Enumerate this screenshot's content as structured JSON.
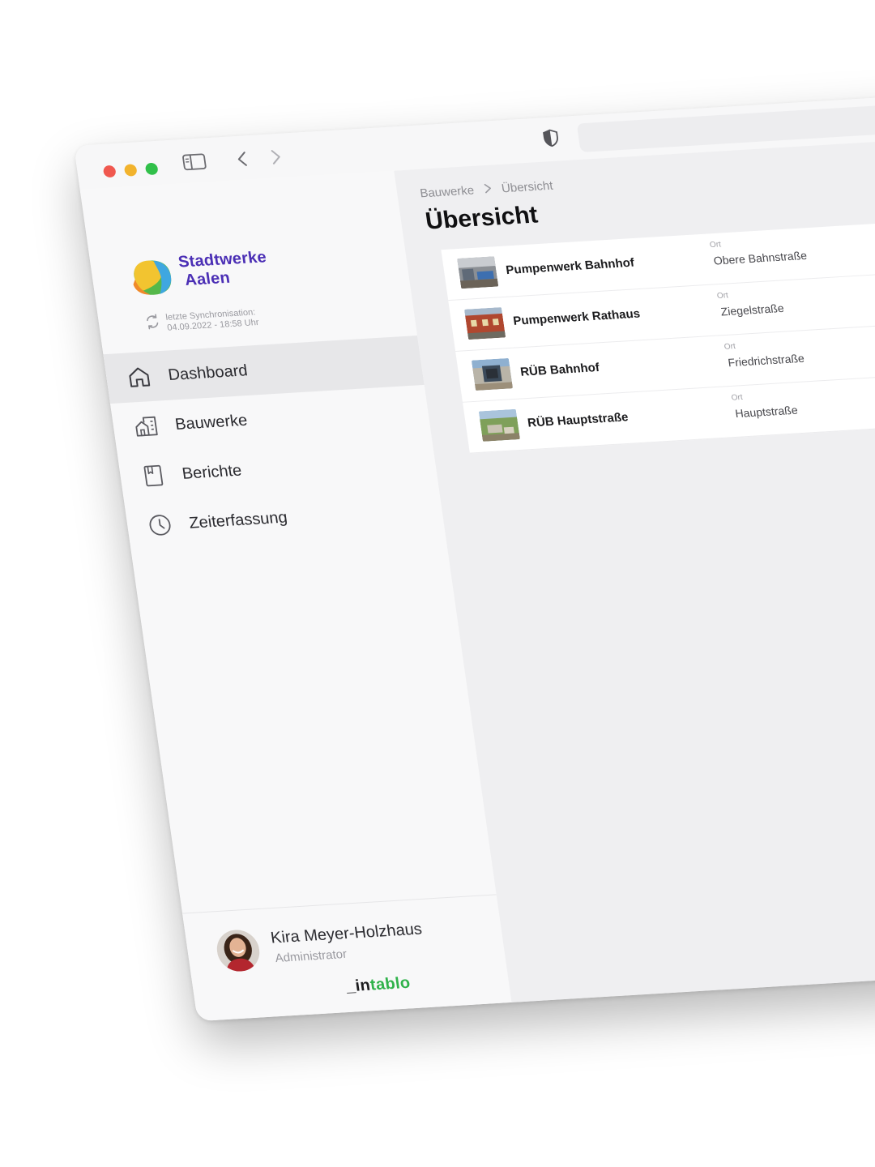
{
  "sidebar": {
    "brand": {
      "line1": "Stadtwerke",
      "line2": "Aalen"
    },
    "sync": {
      "label": "letzte Synchronisation:",
      "datetime": "04.09.2022 - 18:58 Uhr"
    },
    "items": [
      {
        "label": "Dashboard",
        "icon": "home-icon",
        "active": true
      },
      {
        "label": "Bauwerke",
        "icon": "building-icon",
        "active": false
      },
      {
        "label": "Berichte",
        "icon": "report-icon",
        "active": false
      },
      {
        "label": "Zeiterfassung",
        "icon": "clock-icon",
        "active": false
      }
    ],
    "user": {
      "name": "Kira Meyer-Holzhaus",
      "role": "Administrator"
    },
    "footer_logo": {
      "prefix": "_in",
      "suffix": "tablo"
    }
  },
  "main": {
    "breadcrumb": [
      "Bauwerke",
      "Übersicht"
    ],
    "title": "Übersicht",
    "column_label": "Ort",
    "rows": [
      {
        "name": "Pumpenwerk Bahnhof",
        "ort": "Obere Bahnstraße"
      },
      {
        "name": "Pumpenwerk Rathaus",
        "ort": "Ziegelstraße"
      },
      {
        "name": "RÜB Bahnhof",
        "ort": "Friedrichstraße"
      },
      {
        "name": "RÜB Hauptstraße",
        "ort": "Hauptstraße"
      }
    ]
  },
  "colors": {
    "brand_purple": "#4b2fb5",
    "intablo_green": "#2fb24a",
    "traffic_red": "#f0584f",
    "traffic_yellow": "#f2b32d",
    "traffic_green": "#31c04a"
  }
}
